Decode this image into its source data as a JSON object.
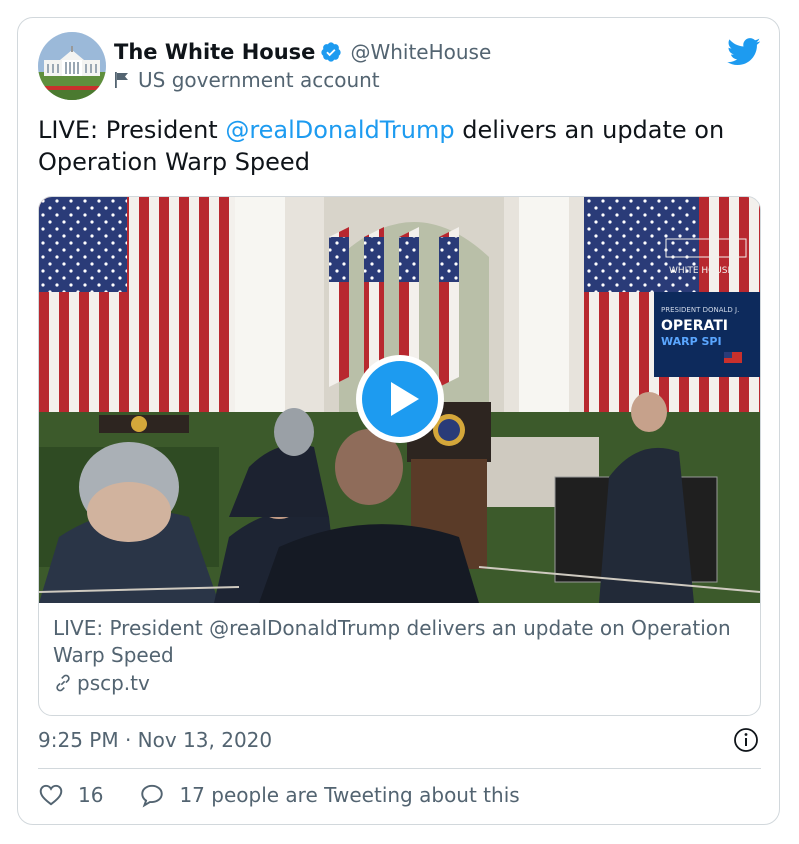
{
  "author": {
    "display_name": "The White House",
    "handle": "@WhiteHouse",
    "label": "US government account",
    "avatar_icon": "white-house-avatar-icon",
    "verified_icon": "verified-badge-icon"
  },
  "tweet": {
    "text_prefix": "LIVE: President ",
    "mention": "@realDonaldTrump",
    "text_suffix": " delivers an update on Operation Warp Speed",
    "timestamp": "9:25 PM · Nov 13, 2020"
  },
  "media_card": {
    "video_overlay": {
      "logo_text": "WHITE HOUSE",
      "screen_line1": "PRESIDENT DONALD J.",
      "screen_line2": "OPERATI",
      "screen_line3": "WARP SPI"
    },
    "caption": "LIVE: President @realDonaldTrump delivers an update on Operation Warp Speed",
    "domain": "pscp.tv"
  },
  "engagement": {
    "likes": "16",
    "tweeting_text": "17 people are Tweeting about this"
  },
  "colors": {
    "accent": "#1d9bf0",
    "text": "#0f1419",
    "secondary": "#536471",
    "border": "#d2d8dc"
  }
}
